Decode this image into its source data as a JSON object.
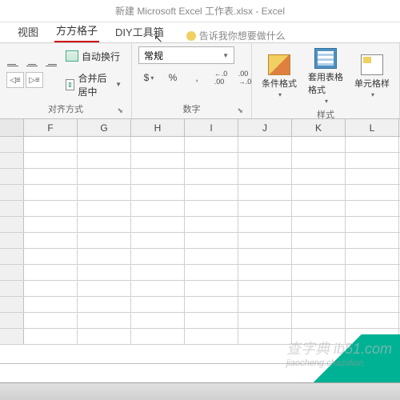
{
  "title": "新建 Microsoft Excel 工作表.xlsx - Excel",
  "tabs": {
    "view": "视图",
    "fangfang": "方方格子",
    "diy": "DIY工具箱"
  },
  "tellme": "告诉我你想要做什么",
  "ribbon": {
    "align": {
      "wrap": "自动换行",
      "merge": "合并后居中",
      "label": "对齐方式"
    },
    "number": {
      "format": "常规",
      "currency": "$",
      "percent": "%",
      "comma": ",",
      "inc": ".00→.0",
      "dec": ".0→.00",
      "label": "数字"
    },
    "styles": {
      "cond": "条件格式",
      "table": "套用表格格式",
      "cell": "单元格样",
      "label": "样式"
    }
  },
  "columns": [
    "F",
    "G",
    "H",
    "I",
    "J",
    "K",
    "L"
  ],
  "watermark": {
    "main": "查字典 ib51.com",
    "sub": "jiaocheng.chazidian"
  }
}
